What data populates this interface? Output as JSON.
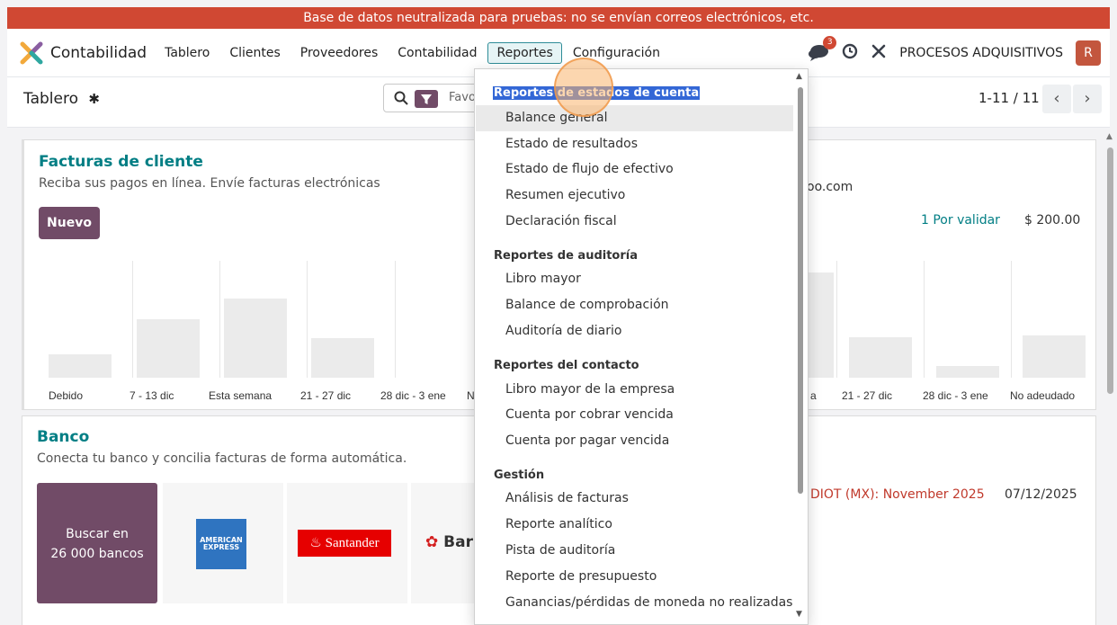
{
  "banner": {
    "text": "Base de datos neutralizada para pruebas: no se envían correos electrónicos, etc."
  },
  "navbar": {
    "app_name": "Contabilidad",
    "menu": [
      "Tablero",
      "Clientes",
      "Proveedores",
      "Contabilidad",
      "Reportes",
      "Configuración"
    ],
    "active_menu": "Reportes",
    "chat_badge": "3",
    "company": "PROCESOS ADQUISITIVOS",
    "avatar_letter": "R"
  },
  "controlbar": {
    "title": "Tablero",
    "search_text": "Favo",
    "pager": "1-11 / 11",
    "prev": "‹",
    "next": "›"
  },
  "card_facturas": {
    "title": "Facturas de cliente",
    "subtitle": "Reciba sus pagos en línea. Envíe facturas electrónicas",
    "new_button": "Nuevo",
    "email_fragment": "oo.com",
    "pending": "1 Por validar",
    "amount": "$ 200.00",
    "x_labels_left": [
      "Debido",
      "7 - 13 dic",
      "Esta semana",
      "21 - 27 dic",
      "28 dic - 3 ene",
      "N"
    ],
    "x_labels_right": [
      "a",
      "21 - 27 dic",
      "28 dic - 3 ene",
      "No adeudado"
    ]
  },
  "chart_data": {
    "type": "bar",
    "categories": [
      "Debido",
      "7 - 13 dic",
      "Esta semana",
      "21 - 27 dic",
      "28 dic - 3 ene",
      "No adeudado"
    ],
    "series": [
      {
        "values": [
          20,
          50,
          68,
          34,
          0,
          0
        ]
      },
      {
        "values": [
          0,
          0,
          0,
          35,
          10,
          36
        ]
      }
    ]
  },
  "card_banco": {
    "title": "Banco",
    "subtitle": "Conecta tu banco y concilia facturas de forma automática.",
    "search_button_line1": "Buscar en",
    "search_button_line2": "26 000 bancos",
    "amex_line1": "AMERICAN",
    "amex_line2": "EXPRESS",
    "santander": "Santander",
    "banorte": "Bar",
    "diot": "DIOT (MX): November 2025",
    "diot_date": "07/12/2025"
  },
  "dropdown": {
    "sections": [
      {
        "title": "Reportes de estados de cuenta",
        "items": [
          "Balance general",
          "Estado de resultados",
          "Estado de flujo de efectivo",
          "Resumen ejecutivo",
          "Declaración fiscal"
        ]
      },
      {
        "title": "Reportes de auditoría",
        "items": [
          "Libro mayor",
          "Balance de comprobación",
          "Auditoría de diario"
        ]
      },
      {
        "title": "Reportes del contacto",
        "items": [
          "Libro mayor de la empresa",
          "Cuenta por cobrar vencida",
          "Cuenta por pagar vencida"
        ]
      },
      {
        "title": "Gestión",
        "items": [
          "Análisis de facturas",
          "Reporte analítico",
          "Pista de auditoría",
          "Reporte de presupuesto",
          "Ganancias/pérdidas de moneda no realizadas"
        ]
      }
    ]
  }
}
